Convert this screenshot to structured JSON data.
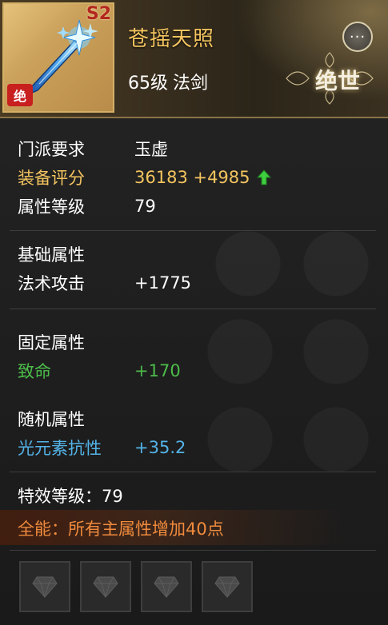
{
  "header": {
    "item_name": "苍摇天照",
    "level": "65级",
    "weapon_type": "法剑",
    "tier_badge": "S2",
    "quality_badge": "绝",
    "rarity_label": "绝世",
    "more_label": "···"
  },
  "base_info": [
    {
      "key": "门派要求",
      "value": "玉虚"
    },
    {
      "key": "装备评分",
      "value": "36183 +4985"
    },
    {
      "key": "属性等级",
      "value": "79"
    }
  ],
  "basic_attrs": {
    "title": "基础属性",
    "rows": [
      {
        "key": "法术攻击",
        "value": "+1775"
      }
    ]
  },
  "fixed_attrs": {
    "title": "固定属性",
    "rows": [
      {
        "key": "致命",
        "value": "+170"
      }
    ]
  },
  "random_attrs": {
    "title": "随机属性",
    "rows": [
      {
        "key": "光元素抗性",
        "value": "+35.2"
      }
    ]
  },
  "special": {
    "level_label": "特效等级：79",
    "effect": "全能：所有主属性增加40点"
  },
  "gem_slots": [
    {
      "icon": "gem-icon"
    },
    {
      "icon": "gem-icon"
    },
    {
      "icon": "gem-icon"
    },
    {
      "icon": "gem-icon"
    }
  ],
  "colors": {
    "gold": "#f3c45f",
    "green": "#4cbc4a",
    "blue": "#54b3e8",
    "effect_orange": "#f08b3d"
  }
}
